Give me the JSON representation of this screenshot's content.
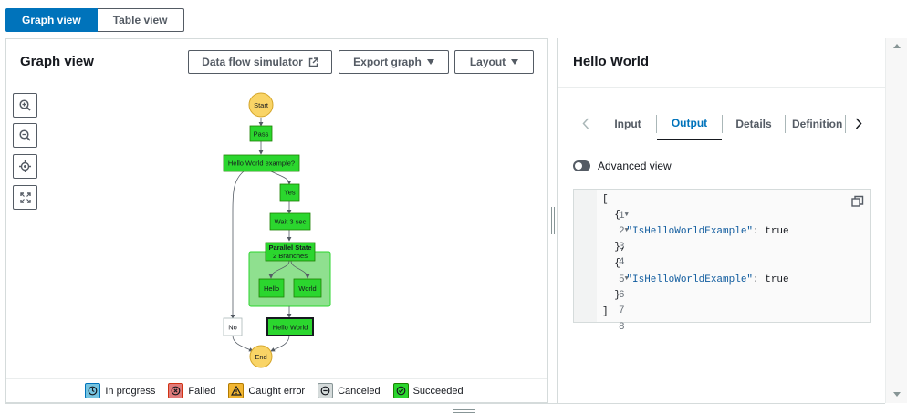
{
  "view_toggle": {
    "graph_view": "Graph view",
    "table_view": "Table view"
  },
  "graph_panel": {
    "title": "Graph view",
    "data_flow_simulator": "Data flow simulator",
    "export_graph": "Export graph",
    "layout": "Layout"
  },
  "graph": {
    "start": "Start",
    "pass": "Pass",
    "choice": "Hello World example?",
    "yes": "Yes",
    "wait": "Wait 3 sec",
    "parallel_title": "Parallel State",
    "parallel_sub": "2 Branches",
    "hello": "Hello",
    "world": "World",
    "no": "No",
    "hello_world": "Hello World",
    "end": "End"
  },
  "legend": {
    "in_progress": "In progress",
    "failed": "Failed",
    "caught_error": "Caught error",
    "canceled": "Canceled",
    "succeeded": "Succeeded"
  },
  "detail_panel": {
    "title": "Hello World",
    "tabs": [
      "Input",
      "Output",
      "Details",
      "Definition"
    ],
    "active_tab": "Output",
    "advanced_view": "Advanced view",
    "code": {
      "line_numbers": [
        "1",
        "2",
        "3",
        "4",
        "5",
        "6",
        "7",
        "8"
      ],
      "l1": "[",
      "l2": "  {",
      "key": "\"IsHelloWorldExample\"",
      "colon_value": ": true",
      "l4": "  },",
      "l5": "  {",
      "l7": "  }",
      "l8": "]"
    }
  },
  "colors": {
    "accent": "#0073bb",
    "succeeded": "#2bd62e",
    "state_border": "#1d8102",
    "start_end": "#f9d466",
    "parallel_bg": "#8fe08f",
    "in_progress": "#76c4e0",
    "failed": "#e07b7b",
    "caught_error": "#f2b632"
  }
}
